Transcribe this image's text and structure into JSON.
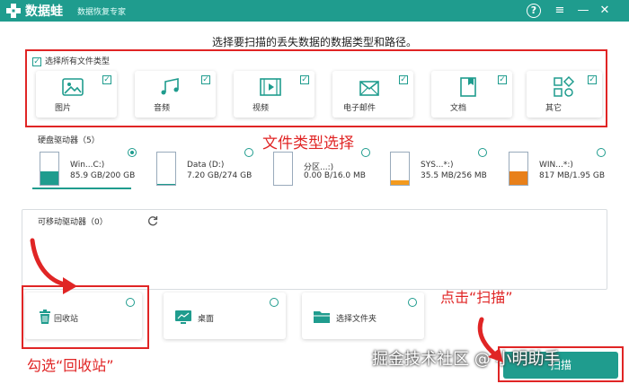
{
  "titlebar": {
    "app_name": "数据蛙",
    "subtitle": "数据恢复专家",
    "help": "?",
    "menu": "≡",
    "minimize": "—",
    "close": "✕"
  },
  "headline": "选择要扫描的丢失数据的数据类型和路径。",
  "file_types": {
    "select_all_label": "选择所有文件类型",
    "select_all_checked": true,
    "items": [
      {
        "label": "图片",
        "icon": "image-icon",
        "checked": true
      },
      {
        "label": "音频",
        "icon": "audio-icon",
        "checked": true
      },
      {
        "label": "视频",
        "icon": "video-icon",
        "checked": true
      },
      {
        "label": "电子邮件",
        "icon": "email-icon",
        "checked": true
      },
      {
        "label": "文档",
        "icon": "document-icon",
        "checked": true
      },
      {
        "label": "其它",
        "icon": "other-icon",
        "checked": true
      }
    ]
  },
  "hard_drives": {
    "title": "硬盘驱动器（5）",
    "items": [
      {
        "name": "Win...C:)",
        "size": "85.9 GB/200 GB",
        "selected": true,
        "fill_fraction": 0.43,
        "color": "#1f9c8e"
      },
      {
        "name": "Data (D:)",
        "size": "7.20 GB/274 GB",
        "selected": false,
        "fill_fraction": 0.03,
        "color": "#1f9c8e"
      },
      {
        "name": "分区...:)",
        "size": "0.00  B/16.0 MB",
        "selected": false,
        "fill_fraction": 0.0,
        "color": "#1f9c8e"
      },
      {
        "name": "SYS...*:)",
        "size": "35.5 MB/256 MB",
        "selected": false,
        "fill_fraction": 0.14,
        "color": "#f39a1e"
      },
      {
        "name": "WIN...*:)",
        "size": "817 MB/1.95 GB",
        "selected": false,
        "fill_fraction": 0.42,
        "color": "#e8801a"
      }
    ]
  },
  "removable": {
    "title": "可移动驱动器（0）"
  },
  "locations": [
    {
      "label": "回收站",
      "icon": "trash-icon",
      "selected": false
    },
    {
      "label": "桌面",
      "icon": "desktop-icon",
      "selected": false
    },
    {
      "label": "选择文件夹",
      "icon": "folder-icon",
      "selected": false
    }
  ],
  "annotations": {
    "types": "文件类型选择",
    "scan": "点击“扫描”",
    "recycle": "勾选“回收站”",
    "watermark": "掘金技术社区 @ 小明助手"
  },
  "scan_button": "扫描",
  "colors": {
    "accent": "#1f9c8e",
    "annotation": "#e02525",
    "warning": "#f39a1e"
  }
}
